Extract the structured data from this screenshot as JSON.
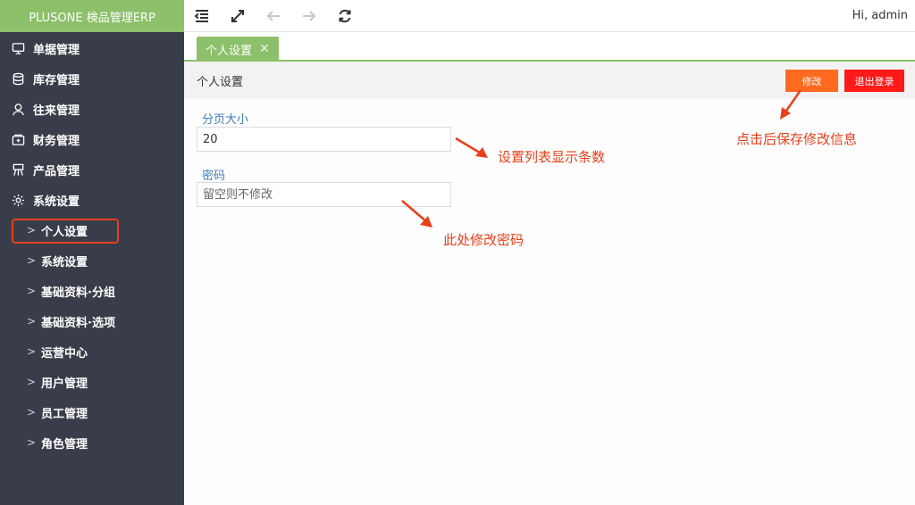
{
  "app": {
    "brand": "PLUSONE 検品管理ERP",
    "user_greeting": "Hi, admin"
  },
  "sidebar": {
    "menu": [
      {
        "label": "单据管理",
        "icon": "monitor-icon"
      },
      {
        "label": "库存管理",
        "icon": "database-icon"
      },
      {
        "label": "往来管理",
        "icon": "user-icon"
      },
      {
        "label": "财务管理",
        "icon": "wallet-icon"
      },
      {
        "label": "产品管理",
        "icon": "product-icon"
      },
      {
        "label": "系统设置",
        "icon": "gear-icon"
      }
    ],
    "submenu": [
      {
        "label": "个人设置",
        "active": true
      },
      {
        "label": "系统设置"
      },
      {
        "label": "基础资料·分组"
      },
      {
        "label": "基础资料·选项"
      },
      {
        "label": "运营中心"
      },
      {
        "label": "用户管理"
      },
      {
        "label": "员工管理"
      },
      {
        "label": "角色管理"
      }
    ]
  },
  "toolbar": {
    "icons": [
      "menu-fold-icon",
      "fullscreen-icon",
      "back-arrow-icon",
      "forward-arrow-icon",
      "refresh-icon"
    ]
  },
  "tabs": [
    {
      "label": "个人设置",
      "close": "✕"
    }
  ],
  "panel": {
    "title": "个人设置",
    "edit_label": "修改",
    "logout_label": "退出登录"
  },
  "form": {
    "page_size_label": "分页大小",
    "page_size_value": "20",
    "password_label": "密码",
    "password_placeholder": "留空则不修改"
  },
  "annotations": {
    "page_size_note": "设置列表显示条数",
    "password_note": "此处修改密码",
    "save_note": "点击后保存修改信息"
  },
  "colors": {
    "accent": "#8cc06a",
    "sidebar": "#393d49",
    "edit": "#ff6a1f",
    "logout": "#ff1a1a",
    "annotation": "#e8401c"
  }
}
